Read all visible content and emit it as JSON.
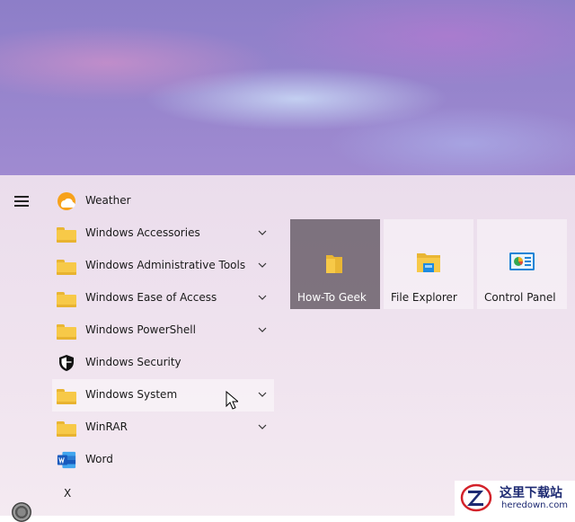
{
  "start_menu": {
    "apps": [
      {
        "label": "Weather",
        "icon": "weather-icon",
        "expandable": false
      },
      {
        "label": "Windows Accessories",
        "icon": "folder-icon",
        "expandable": true
      },
      {
        "label": "Windows Administrative Tools",
        "icon": "folder-icon",
        "expandable": true
      },
      {
        "label": "Windows Ease of Access",
        "icon": "folder-icon",
        "expandable": true
      },
      {
        "label": "Windows PowerShell",
        "icon": "folder-icon",
        "expandable": true
      },
      {
        "label": "Windows Security",
        "icon": "shield-icon",
        "expandable": false
      },
      {
        "label": "Windows System",
        "icon": "folder-icon",
        "expandable": true
      },
      {
        "label": "WinRAR",
        "icon": "folder-icon",
        "expandable": true
      },
      {
        "label": "Word",
        "icon": "word-icon",
        "expandable": false
      }
    ],
    "section_letter": "X",
    "tiles": [
      {
        "label": "How-To Geek",
        "icon": "folder-icon"
      },
      {
        "label": "File Explorer",
        "icon": "file-explorer-icon"
      },
      {
        "label": "Control Panel",
        "icon": "control-panel-icon"
      }
    ]
  },
  "watermark": {
    "title": "这里下载站",
    "url": "heredown.com"
  },
  "colors": {
    "folder": "#f7c948",
    "word_blue": "#185abd",
    "weather_orange": "#f7a21b",
    "tile_dark": "#584e58",
    "watermark_text": "#1d2a72"
  }
}
